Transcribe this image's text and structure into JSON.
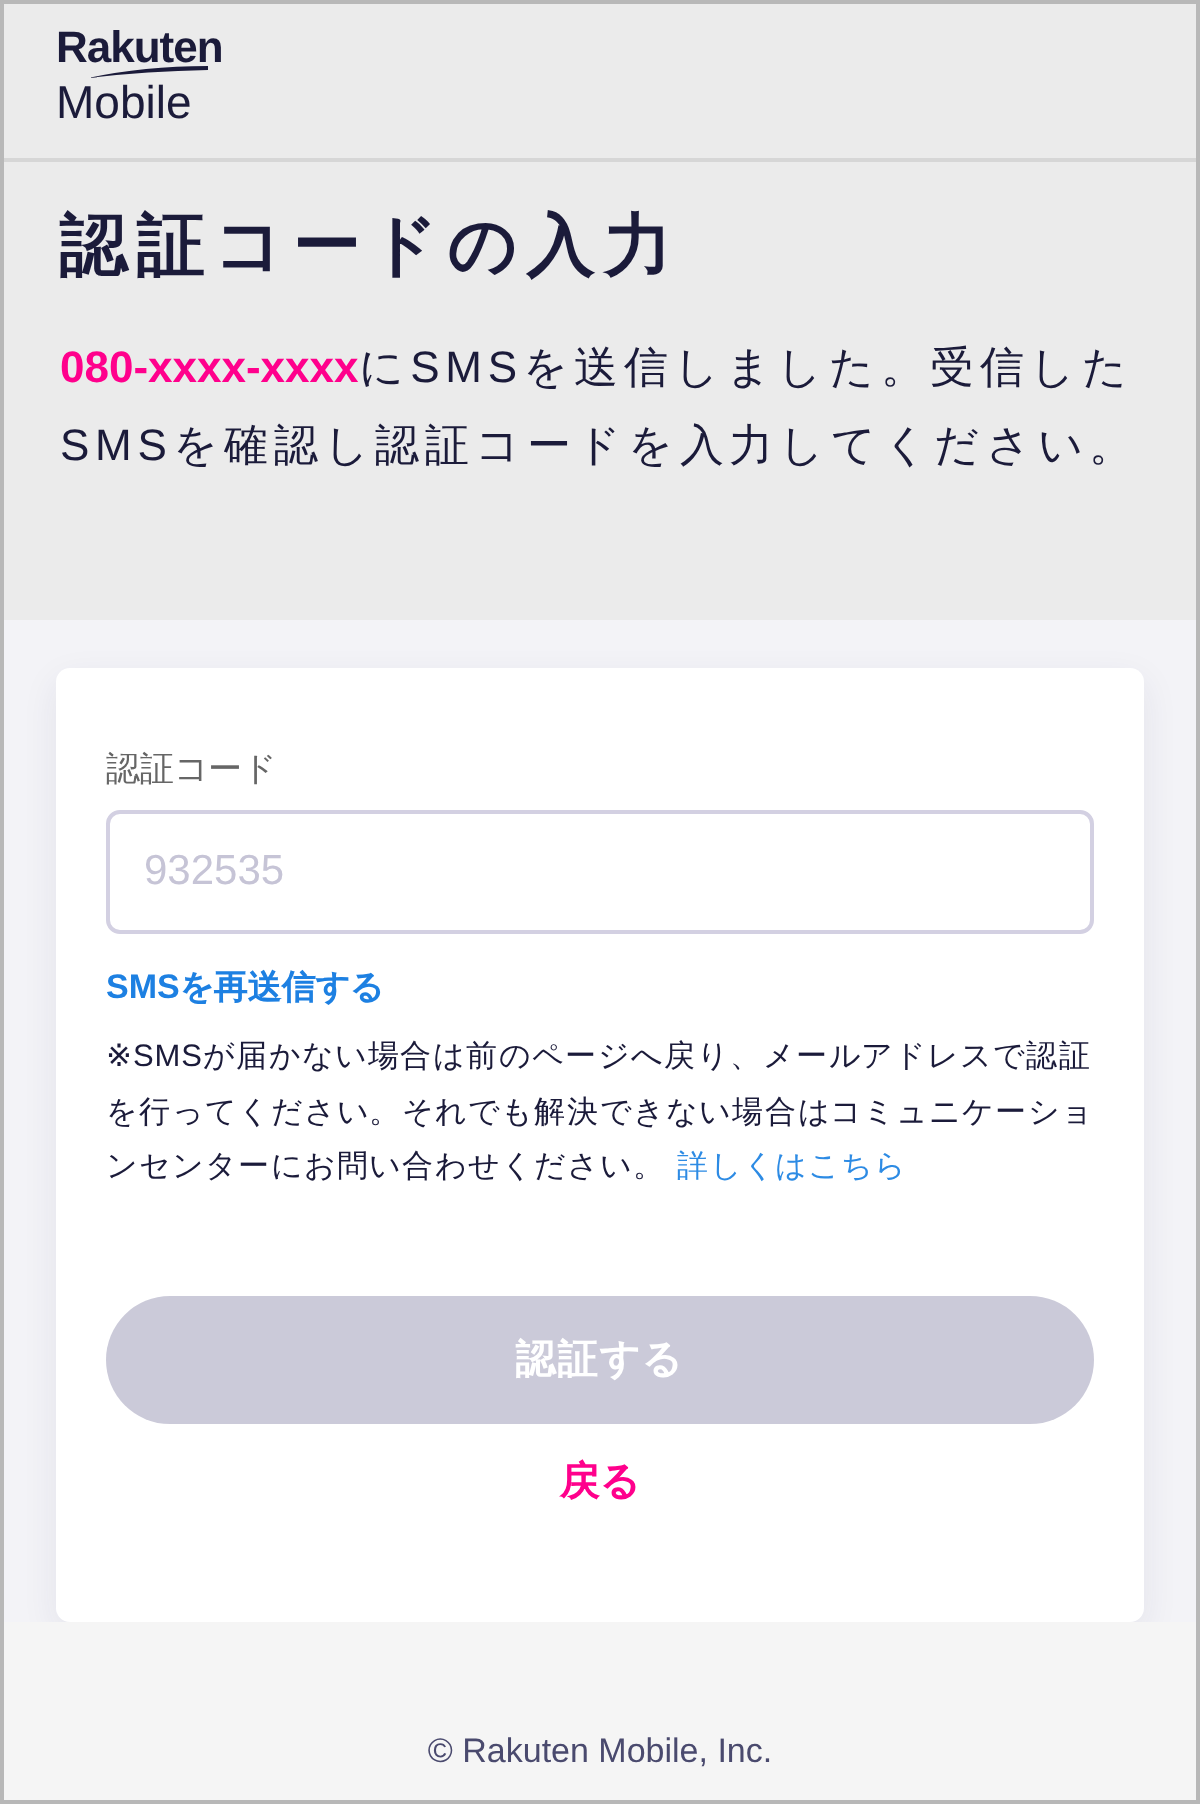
{
  "header": {
    "logo": {
      "line_1": "Rakuten",
      "line_2": "Mobile"
    }
  },
  "intro": {
    "title": "認証コードの入力",
    "phone": "080-xxxx-xxxx",
    "message": "にSMSを送信しました。受信したSMSを確認し認証コードを入力してください。"
  },
  "form": {
    "label": "認証コード",
    "code_field": {
      "placeholder": "932535"
    },
    "resend_link": "SMSを再送信する",
    "notice": "※SMSが届かない場合は前のページへ戻り、メールアドレスで認証を行ってください。それでも解決できない場合はコミュニケーションセンターにお問い合わせください。",
    "details_link": "詳しくはこちら",
    "submit": {
      "label": "認証する",
      "disabled": true
    },
    "back_link": "戻る"
  },
  "footer": {
    "copyright": "© Rakuten Mobile, Inc."
  }
}
